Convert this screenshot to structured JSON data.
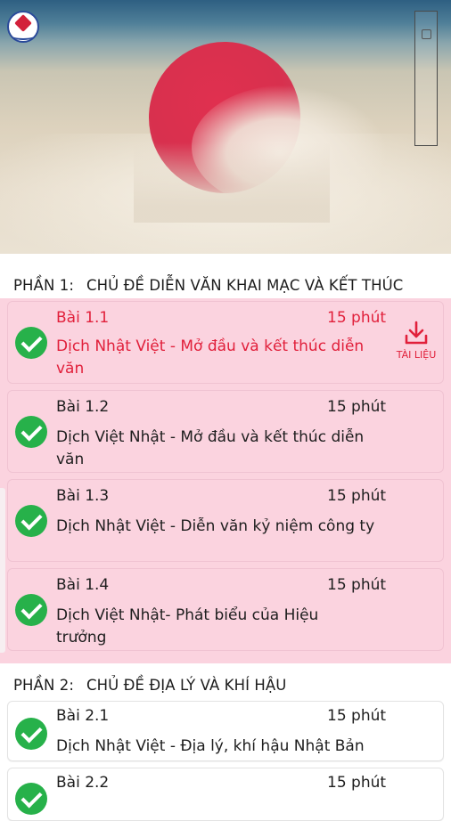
{
  "colors": {
    "accent_red": "#e1203b",
    "check_green": "#27b14a",
    "pink_bg": "#fbd3df",
    "text": "#1e1e1e"
  },
  "banner": {
    "logo_icon": "publisher-logo-icon",
    "vertical_label_icon": "vertical-label-icon"
  },
  "sections": [
    {
      "part_label": "PHẦN 1:",
      "title": "CHỦ ĐỀ DIỄN VĂN KHAI MẠC VÀ KẾT THÚC",
      "lessons": [
        {
          "code": "Bài 1.1",
          "duration": "15 phút",
          "title": "Dịch Nhật Việt - Mở đầu và kết thúc diễn văn",
          "completed": true,
          "active": true
        },
        {
          "code": "Bài 1.2",
          "duration": "15 phút",
          "title": "Dịch Việt Nhật - Mở đầu và kết thúc diễn văn",
          "completed": true
        },
        {
          "code": "Bài 1.3",
          "duration": "15 phút",
          "title": "Dịch Nhật Việt - Diễn văn kỷ niệm công ty",
          "completed": true
        },
        {
          "code": "Bài 1.4",
          "duration": "15 phút",
          "title": "Dịch Việt Nhật- Phát biểu của Hiệu trưởng",
          "completed": true
        }
      ]
    },
    {
      "part_label": "PHẦN 2:",
      "title": "CHỦ ĐỀ ĐỊA LÝ VÀ KHÍ HẬU",
      "lessons": [
        {
          "code": "Bài 2.1",
          "duration": "15 phút",
          "title": "Dịch Nhật Việt - Địa lý, khí hậu Nhật Bản",
          "completed": true
        },
        {
          "code": "Bài 2.2",
          "duration": "15 phút",
          "title": "",
          "completed": true
        }
      ]
    }
  ],
  "download": {
    "label": "TÀI LIỆU",
    "icon": "download-icon"
  }
}
